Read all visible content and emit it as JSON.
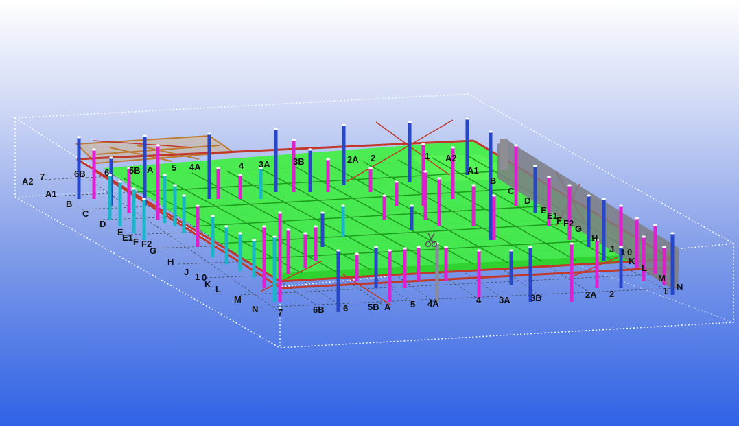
{
  "viewport": {
    "background_top": "#ffffff",
    "background_bottom": "#2f62e6"
  },
  "colors": {
    "slab": "#3ff03f",
    "slab_edge": "#1f9a1f",
    "beam_red": "#c0392b",
    "column_magenta": "#e020d0",
    "column_cyan": "#19b5c8",
    "column_blue": "#2747c8",
    "column_gray": "#8a8a9a",
    "bounding_box": "#ffffff",
    "grid_line": "#333333",
    "label": "#111111"
  },
  "cursor_icon": "scissors-cursor-icon",
  "labels": {
    "front_left": [
      "A2",
      "7",
      "A1",
      "B",
      "C",
      "D",
      "E",
      "E1",
      "F",
      "F2",
      "G",
      "H",
      "J",
      "1",
      "0",
      "K",
      "L",
      "M",
      "N"
    ],
    "front_bottom": [
      "7",
      "6B",
      "6",
      "5B",
      "A",
      "5",
      "4A",
      "4",
      "3A",
      "3B",
      "2A",
      "2",
      "1"
    ],
    "back_top": [
      "6B",
      "6",
      "5B",
      "A",
      "5",
      "4A",
      "4",
      "3A",
      "3B",
      "2A",
      "2",
      "1",
      "A2",
      "A1"
    ],
    "right_side": [
      "B",
      "C",
      "D",
      "E",
      "E1",
      "F",
      "F2",
      "G",
      "H",
      "J",
      "1",
      "0",
      "K",
      "L",
      "M",
      "N"
    ]
  }
}
